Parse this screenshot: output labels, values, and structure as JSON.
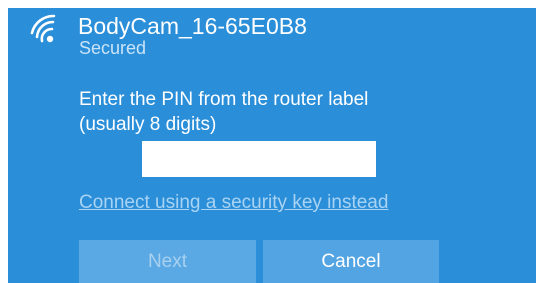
{
  "network": {
    "name": "BodyCam_16-65E0B8",
    "status": "Secured",
    "icon": "wifi-secured-icon"
  },
  "pin_prompt": {
    "line1": "Enter the PIN from the router label",
    "line2": "(usually 8 digits)",
    "input_value": ""
  },
  "alt_link": "Connect using a security key instead",
  "buttons": {
    "next": "Next",
    "cancel": "Cancel"
  },
  "colors": {
    "panel_bg": "#2a8ed9",
    "next_disabled_bg": "#5aa9e4",
    "cancel_bg": "#52a4e3",
    "link": "#a9d3f3"
  }
}
